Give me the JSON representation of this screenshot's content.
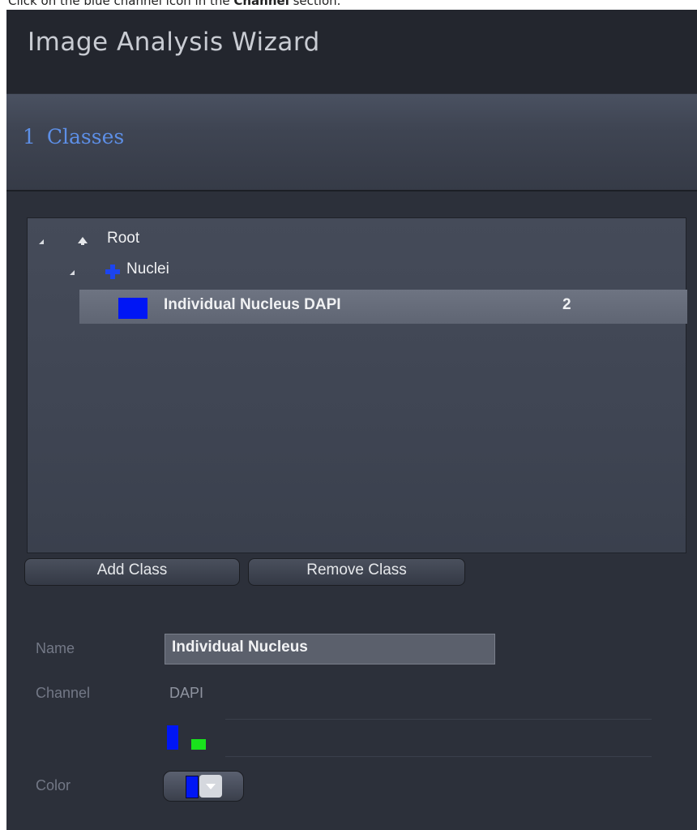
{
  "instruction": {
    "prefix": "Click on the blue channel icon in the ",
    "bold": "Channel",
    "suffix": " section."
  },
  "window": {
    "title": "Image Analysis Wizard"
  },
  "step": {
    "number": "1",
    "title": "Classes"
  },
  "tree": {
    "root_label": "Root",
    "group_label": "Nuclei",
    "class_label": "Individual Nucleus DAPI",
    "class_count": "2"
  },
  "buttons": {
    "add_class": "Add Class",
    "remove_class": "Remove Class"
  },
  "properties": {
    "name_label": "Name",
    "name_value": "Individual Nucleus",
    "channel_label": "Channel",
    "channel_value": "DAPI",
    "color_label": "Color"
  },
  "colors": {
    "accent": "#5d8fe6",
    "class_color": "#0016f5",
    "channel_blue": "#0016f5",
    "channel_green": "#19e21c"
  }
}
